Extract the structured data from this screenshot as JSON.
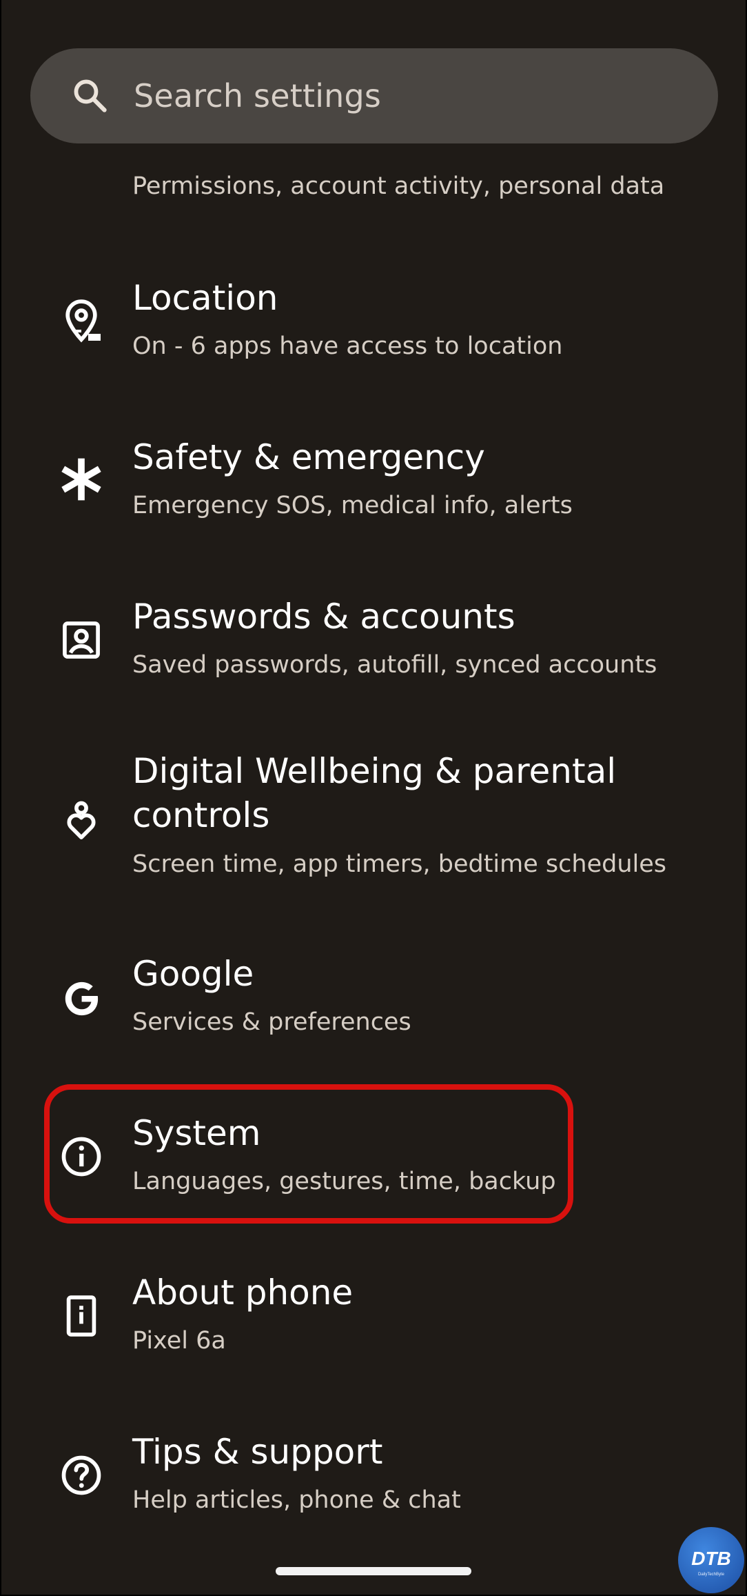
{
  "search": {
    "placeholder": "Search settings",
    "icon": "search-icon"
  },
  "items": [
    {
      "id": "privacy",
      "icon": "privacy-icon",
      "title": "",
      "subtitle": "Permissions, account activity, personal data"
    },
    {
      "id": "location",
      "icon": "location-pin-icon",
      "title": "Location",
      "subtitle": "On - 6 apps have access to location"
    },
    {
      "id": "safety",
      "icon": "asterisk-icon",
      "title": "Safety & emergency",
      "subtitle": "Emergency SOS, medical info, alerts"
    },
    {
      "id": "passwords",
      "icon": "account-box-icon",
      "title": "Passwords & accounts",
      "subtitle": "Saved passwords, autofill, synced accounts"
    },
    {
      "id": "wellbeing",
      "icon": "wellbeing-heart-icon",
      "title_line1": "Digital Wellbeing & parental",
      "title_line2": "controls",
      "subtitle": "Screen time, app timers, bedtime schedules"
    },
    {
      "id": "google",
      "icon": "google-g-icon",
      "title": "Google",
      "subtitle": "Services & preferences"
    },
    {
      "id": "system",
      "icon": "info-icon",
      "title": "System",
      "subtitle": "Languages, gestures, time, backup"
    },
    {
      "id": "about",
      "icon": "phone-info-icon",
      "title": "About phone",
      "subtitle": "Pixel 6a"
    },
    {
      "id": "tips",
      "icon": "help-icon",
      "title": "Tips & support",
      "subtitle": "Help articles, phone & chat"
    }
  ],
  "highlight": {
    "target": "system",
    "color": "#d8110e"
  },
  "watermark": {
    "text": "DTB",
    "subtext": "DailyTechByte"
  },
  "colors": {
    "background": "#1f1b17",
    "search_bar": "#4a4642",
    "title": "#ffffff",
    "subtitle": "#d6cec5"
  }
}
